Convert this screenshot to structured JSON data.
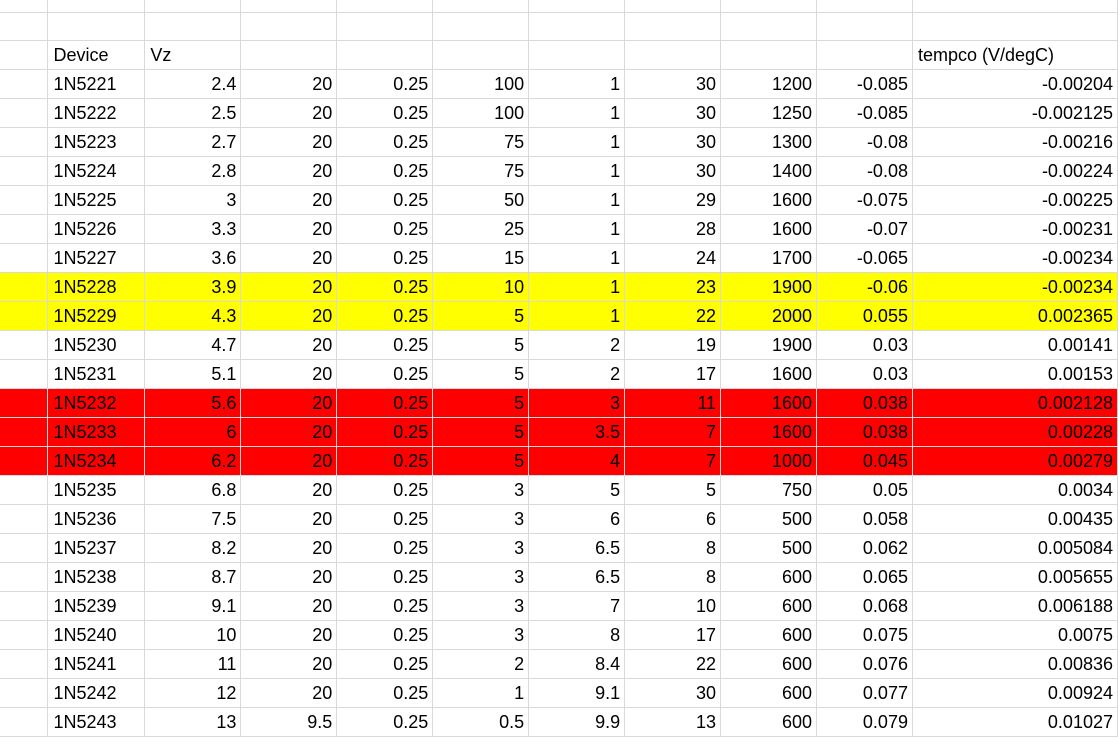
{
  "highlight_colors": {
    "yellow": "#ffff00",
    "red": "#ff0000",
    "gridline": "#d9d9d9"
  },
  "header": {
    "c1": "Device",
    "c2": "Vz",
    "c3": "",
    "c4": "",
    "c5": "",
    "c6": "",
    "c7": "",
    "c8": "",
    "c9": "",
    "c10": "tempco (V/degC)"
  },
  "rows": [
    {
      "device": "1N5221",
      "vz": "2.4",
      "c3": "20",
      "c4": "0.25",
      "c5": "100",
      "c6": "1",
      "c7": "30",
      "c8": "1200",
      "c9": "-0.085",
      "tempco": "-0.00204",
      "hl": ""
    },
    {
      "device": "1N5222",
      "vz": "2.5",
      "c3": "20",
      "c4": "0.25",
      "c5": "100",
      "c6": "1",
      "c7": "30",
      "c8": "1250",
      "c9": "-0.085",
      "tempco": "-0.002125",
      "hl": ""
    },
    {
      "device": "1N5223",
      "vz": "2.7",
      "c3": "20",
      "c4": "0.25",
      "c5": "75",
      "c6": "1",
      "c7": "30",
      "c8": "1300",
      "c9": "-0.08",
      "tempco": "-0.00216",
      "hl": ""
    },
    {
      "device": "1N5224",
      "vz": "2.8",
      "c3": "20",
      "c4": "0.25",
      "c5": "75",
      "c6": "1",
      "c7": "30",
      "c8": "1400",
      "c9": "-0.08",
      "tempco": "-0.00224",
      "hl": ""
    },
    {
      "device": "1N5225",
      "vz": "3",
      "c3": "20",
      "c4": "0.25",
      "c5": "50",
      "c6": "1",
      "c7": "29",
      "c8": "1600",
      "c9": "-0.075",
      "tempco": "-0.00225",
      "hl": ""
    },
    {
      "device": "1N5226",
      "vz": "3.3",
      "c3": "20",
      "c4": "0.25",
      "c5": "25",
      "c6": "1",
      "c7": "28",
      "c8": "1600",
      "c9": "-0.07",
      "tempco": "-0.00231",
      "hl": ""
    },
    {
      "device": "1N5227",
      "vz": "3.6",
      "c3": "20",
      "c4": "0.25",
      "c5": "15",
      "c6": "1",
      "c7": "24",
      "c8": "1700",
      "c9": "-0.065",
      "tempco": "-0.00234",
      "hl": ""
    },
    {
      "device": "1N5228",
      "vz": "3.9",
      "c3": "20",
      "c4": "0.25",
      "c5": "10",
      "c6": "1",
      "c7": "23",
      "c8": "1900",
      "c9": "-0.06",
      "tempco": "-0.00234",
      "hl": "yellow"
    },
    {
      "device": "1N5229",
      "vz": "4.3",
      "c3": "20",
      "c4": "0.25",
      "c5": "5",
      "c6": "1",
      "c7": "22",
      "c8": "2000",
      "c9": "0.055",
      "tempco": "0.002365",
      "hl": "yellow"
    },
    {
      "device": "1N5230",
      "vz": "4.7",
      "c3": "20",
      "c4": "0.25",
      "c5": "5",
      "c6": "2",
      "c7": "19",
      "c8": "1900",
      "c9": "0.03",
      "tempco": "0.00141",
      "hl": ""
    },
    {
      "device": "1N5231",
      "vz": "5.1",
      "c3": "20",
      "c4": "0.25",
      "c5": "5",
      "c6": "2",
      "c7": "17",
      "c8": "1600",
      "c9": "0.03",
      "tempco": "0.00153",
      "hl": ""
    },
    {
      "device": "1N5232",
      "vz": "5.6",
      "c3": "20",
      "c4": "0.25",
      "c5": "5",
      "c6": "3",
      "c7": "11",
      "c8": "1600",
      "c9": "0.038",
      "tempco": "0.002128",
      "hl": "red"
    },
    {
      "device": "1N5233",
      "vz": "6",
      "c3": "20",
      "c4": "0.25",
      "c5": "5",
      "c6": "3.5",
      "c7": "7",
      "c8": "1600",
      "c9": "0.038",
      "tempco": "0.00228",
      "hl": "red"
    },
    {
      "device": "1N5234",
      "vz": "6.2",
      "c3": "20",
      "c4": "0.25",
      "c5": "5",
      "c6": "4",
      "c7": "7",
      "c8": "1000",
      "c9": "0.045",
      "tempco": "0.00279",
      "hl": "red"
    },
    {
      "device": "1N5235",
      "vz": "6.8",
      "c3": "20",
      "c4": "0.25",
      "c5": "3",
      "c6": "5",
      "c7": "5",
      "c8": "750",
      "c9": "0.05",
      "tempco": "0.0034",
      "hl": ""
    },
    {
      "device": "1N5236",
      "vz": "7.5",
      "c3": "20",
      "c4": "0.25",
      "c5": "3",
      "c6": "6",
      "c7": "6",
      "c8": "500",
      "c9": "0.058",
      "tempco": "0.00435",
      "hl": ""
    },
    {
      "device": "1N5237",
      "vz": "8.2",
      "c3": "20",
      "c4": "0.25",
      "c5": "3",
      "c6": "6.5",
      "c7": "8",
      "c8": "500",
      "c9": "0.062",
      "tempco": "0.005084",
      "hl": ""
    },
    {
      "device": "1N5238",
      "vz": "8.7",
      "c3": "20",
      "c4": "0.25",
      "c5": "3",
      "c6": "6.5",
      "c7": "8",
      "c8": "600",
      "c9": "0.065",
      "tempco": "0.005655",
      "hl": ""
    },
    {
      "device": "1N5239",
      "vz": "9.1",
      "c3": "20",
      "c4": "0.25",
      "c5": "3",
      "c6": "7",
      "c7": "10",
      "c8": "600",
      "c9": "0.068",
      "tempco": "0.006188",
      "hl": ""
    },
    {
      "device": "1N5240",
      "vz": "10",
      "c3": "20",
      "c4": "0.25",
      "c5": "3",
      "c6": "8",
      "c7": "17",
      "c8": "600",
      "c9": "0.075",
      "tempco": "0.0075",
      "hl": ""
    },
    {
      "device": "1N5241",
      "vz": "11",
      "c3": "20",
      "c4": "0.25",
      "c5": "2",
      "c6": "8.4",
      "c7": "22",
      "c8": "600",
      "c9": "0.076",
      "tempco": "0.00836",
      "hl": ""
    },
    {
      "device": "1N5242",
      "vz": "12",
      "c3": "20",
      "c4": "0.25",
      "c5": "1",
      "c6": "9.1",
      "c7": "30",
      "c8": "600",
      "c9": "0.077",
      "tempco": "0.00924",
      "hl": ""
    },
    {
      "device": "1N5243",
      "vz": "13",
      "c3": "9.5",
      "c4": "0.25",
      "c5": "0.5",
      "c6": "9.9",
      "c7": "13",
      "c8": "600",
      "c9": "0.079",
      "tempco": "0.01027",
      "hl": ""
    }
  ]
}
